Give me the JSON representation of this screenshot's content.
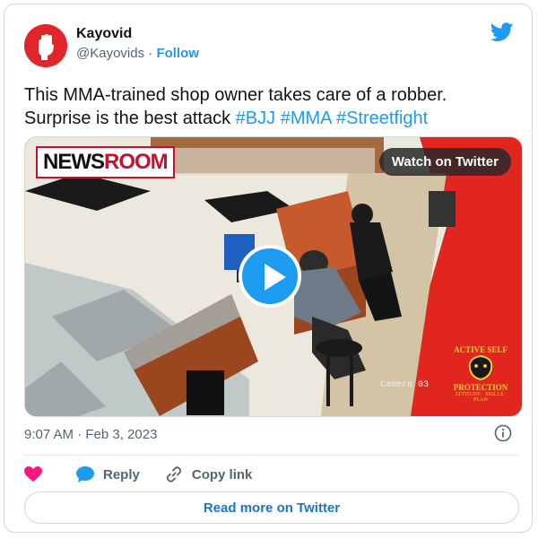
{
  "author": {
    "name": "Kayovid",
    "handle": "@Kayovids",
    "separator": " · ",
    "follow_label": "Follow"
  },
  "tweet": {
    "text_line1": "This MMA-trained shop owner takes care of a robber.",
    "text_line2_prefix": "Surprise is the best attack ",
    "hashtags": [
      "#BJJ",
      "#MMA",
      "#Streetfight"
    ]
  },
  "media": {
    "watch_label": "Watch on Twitter",
    "newsroom_part1": "NEWS",
    "newsroom_part2": "ROOM",
    "camera_label": "Camera 03",
    "logo_line1": "ACTIVE SELF",
    "logo_line2": "PROTECTION",
    "logo_line3": "ATTITUDE · SKILLS · PLAN"
  },
  "timestamp": "9:07 AM · Feb 3, 2023",
  "actions": {
    "reply_label": "Reply",
    "copy_link_label": "Copy link"
  },
  "read_more_label": "Read more on Twitter",
  "colors": {
    "accent": "#1d9bf0",
    "like": "#f91880",
    "avatar_bg": "#e0262b"
  },
  "icons": [
    "twitter-bird-icon",
    "play-icon",
    "info-icon",
    "heart-icon",
    "reply-icon",
    "link-icon"
  ]
}
